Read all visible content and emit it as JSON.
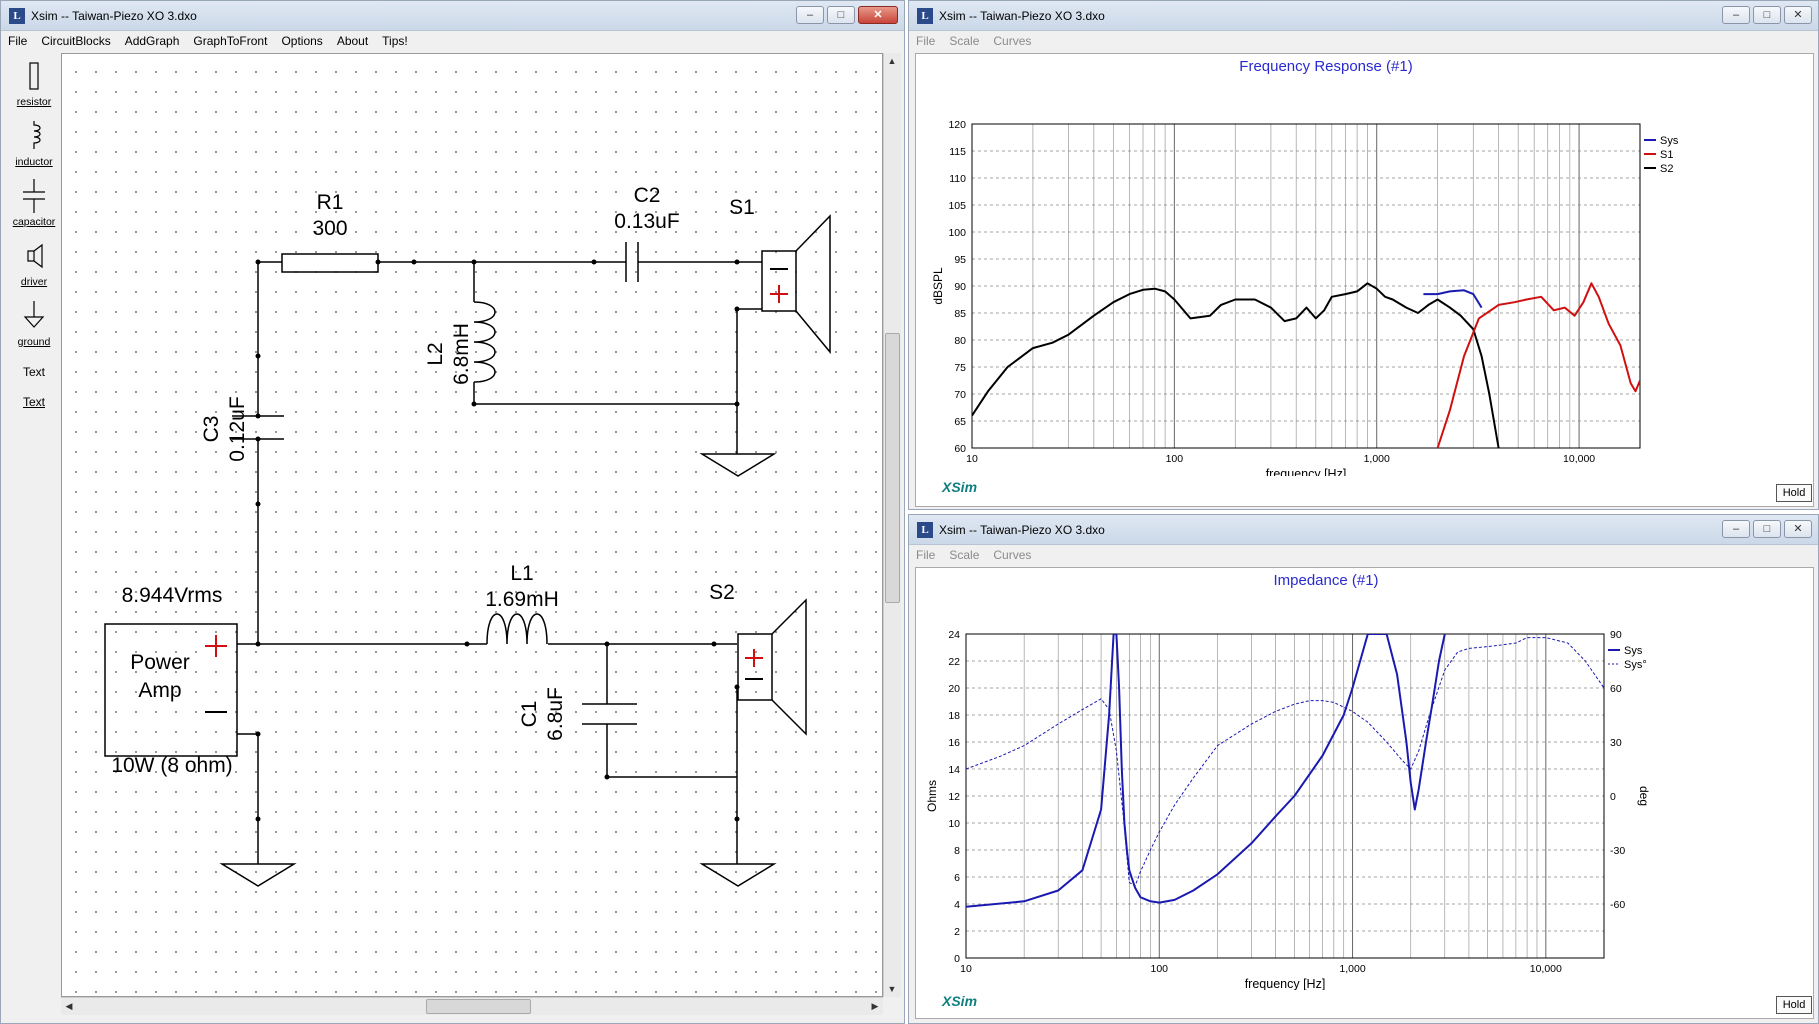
{
  "left_window": {
    "title": "Xsim -- Taiwan-Piezo XO 3.dxo",
    "menu": [
      "File",
      "CircuitBlocks",
      "AddGraph",
      "GraphToFront",
      "Options",
      "About",
      "Tips!"
    ],
    "tools": [
      {
        "label": "resistor",
        "icon": "resistor-icon"
      },
      {
        "label": "inductor",
        "icon": "inductor-icon"
      },
      {
        "label": "capacitor",
        "icon": "capacitor-icon"
      },
      {
        "label": "driver",
        "icon": "driver-icon"
      },
      {
        "label": "ground",
        "icon": "ground-icon"
      },
      {
        "label": "Text",
        "icon": ""
      },
      {
        "label": "Text",
        "icon": ""
      }
    ],
    "circuit": {
      "r1_name": "R1",
      "r1_value": "300",
      "c2_name": "C2",
      "c2_value": "0.13uF",
      "s1_name": "S1",
      "l2_name": "L2",
      "l2_value": "6.8mH",
      "c3_name": "C3",
      "c3_value": "0.12uF",
      "l1_name": "L1",
      "l1_value": "1.69mH",
      "s2_name": "S2",
      "c1_name": "C1",
      "c1_value": "6.8uF",
      "amp_voltage": "8.944Vrms",
      "amp_line1": "Power",
      "amp_line2": "Amp",
      "amp_rating": "10W (8 ohm)"
    }
  },
  "freq_window": {
    "title": "Xsim -- Taiwan-Piezo XO 3.dxo",
    "menu": [
      "File",
      "Scale",
      "Curves"
    ],
    "hold": "Hold",
    "logo": "XSim",
    "chart_data": {
      "type": "line",
      "title": "Frequency Response (#1)",
      "xlabel": "frequency [Hz]",
      "ylabel": "dBSPL",
      "x_scale": "log",
      "xlim": [
        10,
        20000
      ],
      "ylim": [
        60,
        120
      ],
      "x_ticks": [
        "10",
        "100",
        "1,000",
        "10,000"
      ],
      "y_ticks": [
        "60",
        "65",
        "70",
        "75",
        "80",
        "85",
        "90",
        "95",
        "100",
        "105",
        "110",
        "115",
        "120"
      ],
      "grid": true,
      "legend_position": "top-right",
      "series": [
        {
          "name": "Sys",
          "color": "#1a1ab0",
          "x": [
            1700,
            2000,
            2300,
            2700,
            3000,
            3300
          ],
          "y": [
            88.5,
            88.5,
            89.0,
            89.2,
            88.5,
            86.0
          ]
        },
        {
          "name": "S1",
          "color": "#d01010",
          "x": [
            2000,
            2300,
            2700,
            3200,
            4000,
            4800,
            5500,
            6500,
            7500,
            8500,
            9500,
            10500,
            11500,
            12500,
            14000,
            16000,
            18000,
            19000,
            20000
          ],
          "y": [
            60,
            67,
            77,
            84,
            86.5,
            87,
            87.5,
            88,
            85.5,
            86,
            84.5,
            87,
            90.5,
            88,
            83,
            79,
            72,
            70.5,
            72.5
          ]
        },
        {
          "name": "S2",
          "color": "#000000",
          "x": [
            10,
            12,
            15,
            20,
            25,
            30,
            40,
            50,
            60,
            70,
            80,
            90,
            100,
            120,
            150,
            170,
            200,
            250,
            300,
            350,
            400,
            450,
            500,
            550,
            600,
            700,
            800,
            900,
            1000,
            1100,
            1200,
            1400,
            1600,
            1800,
            2000,
            2300,
            2600,
            3000,
            3300,
            3600,
            4000
          ],
          "y": [
            66,
            70.5,
            75,
            78.5,
            79.5,
            81,
            84.5,
            87,
            88.5,
            89.3,
            89.5,
            89,
            87.5,
            84,
            84.5,
            86.5,
            87.5,
            87.5,
            86,
            83.5,
            84,
            86,
            84,
            85.5,
            88,
            88.5,
            89,
            90.5,
            89.5,
            88,
            87.5,
            86,
            85,
            86.5,
            87.5,
            86,
            84.5,
            82,
            77,
            70,
            60
          ]
        }
      ]
    }
  },
  "imp_window": {
    "title": "Xsim -- Taiwan-Piezo XO 3.dxo",
    "menu": [
      "File",
      "Scale",
      "Curves"
    ],
    "hold": "Hold",
    "logo": "XSim",
    "chart_data": {
      "type": "line",
      "title": "Impedance (#1)",
      "xlabel": "frequency [Hz]",
      "ylabel": "Ohms",
      "y2label": "deg",
      "x_scale": "log",
      "xlim": [
        10,
        20000
      ],
      "ylim": [
        0,
        24
      ],
      "y2lim": [
        -90,
        90
      ],
      "x_ticks": [
        "10",
        "100",
        "1,000",
        "10,000"
      ],
      "y_ticks": [
        "0",
        "2",
        "4",
        "6",
        "8",
        "10",
        "12",
        "14",
        "16",
        "18",
        "20",
        "22",
        "24"
      ],
      "y2_ticks": [
        "-60",
        "-30",
        "0",
        "30",
        "60",
        "90"
      ],
      "grid": true,
      "legend_position": "top-right",
      "series": [
        {
          "name": "Sys",
          "color": "#1a1ab0",
          "axis": "left",
          "x": [
            10,
            20,
            30,
            40,
            50,
            55,
            58,
            60,
            62,
            64,
            66,
            68,
            70,
            75,
            80,
            90,
            100,
            120,
            150,
            200,
            300,
            400,
            500,
            700,
            900,
            1000,
            1200,
            1500,
            1700,
            1900,
            2000,
            2100,
            2200,
            2400,
            2600,
            2800,
            3000
          ],
          "y": [
            3.8,
            4.2,
            5.0,
            6.5,
            11,
            18,
            24,
            24,
            20,
            14,
            10,
            8,
            6.5,
            5.2,
            4.5,
            4.2,
            4.1,
            4.3,
            5,
            6.2,
            8.5,
            10.5,
            12,
            15,
            18,
            20,
            24,
            24,
            21,
            16,
            13,
            11,
            12.5,
            16,
            19,
            22,
            24
          ]
        },
        {
          "name": "Sys°",
          "color": "#1a1ab0",
          "axis": "right",
          "dashed": true,
          "x": [
            10,
            15,
            20,
            30,
            40,
            50,
            55,
            60,
            65,
            70,
            75,
            80,
            90,
            100,
            120,
            150,
            200,
            300,
            400,
            500,
            600,
            700,
            800,
            1000,
            1200,
            1500,
            1800,
            2000,
            2200,
            2500,
            3000,
            3500,
            4000,
            5000,
            6000,
            7000,
            8000,
            10000,
            13000,
            16000,
            20000
          ],
          "y": [
            15,
            22,
            28,
            40,
            48,
            54,
            48,
            25,
            -10,
            -48,
            -50,
            -42,
            -30,
            -20,
            -5,
            10,
            28,
            40,
            47,
            51,
            53,
            53,
            52,
            47,
            41,
            30,
            20,
            15,
            25,
            45,
            70,
            80,
            82,
            83,
            84,
            85,
            88,
            88,
            85,
            75,
            60
          ]
        }
      ]
    }
  }
}
